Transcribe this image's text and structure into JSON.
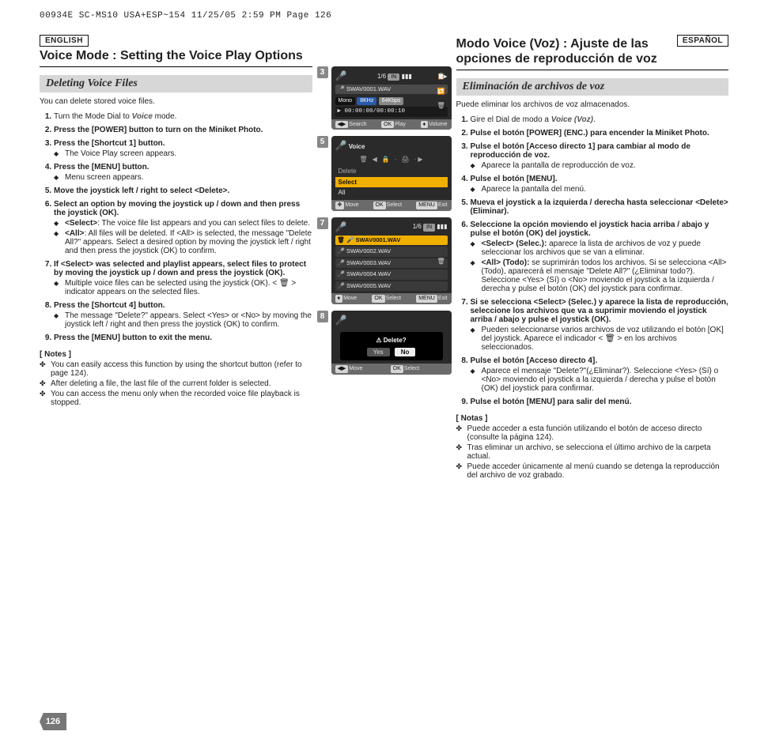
{
  "slug": "00934E SC-MS10 USA+ESP~154  11/25/05 2:59 PM  Page 126",
  "page_number": "126",
  "en": {
    "lang_badge": "ENGLISH",
    "title": "Voice Mode : Setting the Voice Play Options",
    "subhead": "Deleting Voice Files",
    "intro": "You can delete stored voice files.",
    "mode_label_prefix": "Turn the Mode Dial to ",
    "mode_name": "Voice",
    "mode_label_suffix": " mode.",
    "step2": "Press the [POWER] button to turn on the Miniket Photo.",
    "step3": "Press the [Shortcut 1] button.",
    "step3_b1": "The Voice Play screen appears.",
    "step4": "Press the [MENU] button.",
    "step4_b1": "Menu screen appears.",
    "step5": "Move the joystick left / right to select <Delete>.",
    "step6": "Select an option by moving the joystick up / down and then press the joystick (OK).",
    "step6_b1_label": "<Select>",
    "step6_b1_text": ": The voice file list appears and you can select files to delete.",
    "step6_b2_label": "<All>",
    "step6_b2_text": ": All files will be deleted. If <All> is selected, the message \"Delete All?\" appears. Select a desired option by moving the joystick left / right and then press the joystick (OK) to confirm.",
    "step7": "If <Select> was selected and playlist appears, select files to protect by moving the joystick up / down and press the joystick (OK).",
    "step7_b1": "Multiple voice files can be selected using the joystick (OK). < 🗑 > indicator appears on the selected files.",
    "step8": "Press the [Shortcut 4] button.",
    "step8_b1": "The message \"Delete?\" appears. Select <Yes> or <No> by moving the joystick left / right and then press the joystick (OK) to confirm.",
    "step9": "Press the [MENU] button to exit the menu.",
    "notes_head": "[ Notes ]",
    "note1": "You can easily access this function by using the shortcut button (refer to page 124).",
    "note2": "After deleting a file, the last file of the current folder is selected.",
    "note3": "You can access the menu only when the recorded voice file playback is stopped."
  },
  "es": {
    "lang_badge": "ESPAÑOL",
    "title": "Modo Voice (Voz) : Ajuste de las opciones de reproducción de voz",
    "subhead": "Eliminación de archivos de voz",
    "intro": "Puede eliminar los archivos de voz almacenados.",
    "mode_label_prefix": "Gire el Dial de modo a ",
    "mode_name": "Voice (Voz)",
    "mode_label_suffix": ".",
    "step2": "Pulse el botón [POWER] (ENC.) para encender la Miniket Photo.",
    "step3": "Pulse el botón [Acceso directo 1] para cambiar al modo de reproducción de voz.",
    "step3_b1": "Aparece la pantalla de reproducción de voz.",
    "step4": "Pulse el botón [MENU].",
    "step4_b1": "Aparece la pantalla del menú.",
    "step5": "Mueva el joystick a la izquierda / derecha hasta seleccionar <Delete> (Eliminar).",
    "step6": "Seleccione la opción moviendo el joystick hacia arriba / abajo y pulse el botón (OK) del joystick.",
    "step6_b1_label": "<Select> (Selec.):",
    "step6_b1_text": " aparece la lista de archivos de voz y puede seleccionar los archivos que se van a eliminar.",
    "step6_b2_label": "<All> (Todo):",
    "step6_b2_text": " se suprimirán todos los archivos. Si se selecciona <All> (Todo), aparecerá el mensaje \"Delete All?\" (¿Eliminar todo?). Seleccione <Yes> (Sí) o <No> moviendo el joystick a la izquierda / derecha y pulse el botón (OK) del joystick para confirmar.",
    "step7": "Si se selecciona <Select> (Selec.) y aparece la lista de reproducción, seleccione los archivos que va a suprimir moviendo el joystick arriba / abajo y pulse el joystick (OK).",
    "step7_b1": "Pueden seleccionarse varios archivos de voz utilizando el botón [OK] del joystick. Aparece el indicador <  🗑  > en los archivos seleccionados.",
    "step8": "Pulse el botón [Acceso directo 4].",
    "step8_b1": "Aparece el mensaje \"Delete?\"(¿Eliminar?). Seleccione <Yes> (Sí) o <No> moviendo el joystick a la izquierda / derecha y pulse el botón (OK) del joystick para confirmar.",
    "step9": "Pulse el botón [MENU] para salir del menú.",
    "notes_head": "[ Notas ]",
    "note1": "Puede acceder a esta función utilizando el botón de acceso directo (consulte la página 124).",
    "note2": "Tras eliminar un archivo, se selecciona el último archivo de la carpeta actual.",
    "note3": "Puede acceder únicamente al menú cuando se detenga la reproducción del archivo de voz grabado."
  },
  "shots": {
    "s3": {
      "num": "3",
      "counter": "1/6",
      "in": "IN",
      "file": "SWAV0001.WAV",
      "mono": "Mono",
      "khz": "8KHz",
      "kbps": "64Kbps",
      "time": "00:00:00/00:00:10",
      "bb_search": "Search",
      "bb_play": "Play",
      "bb_ok": "OK",
      "bb_vol": "Volume"
    },
    "s5": {
      "num": "5",
      "title": "Voice",
      "item_delete": "Delete",
      "item_select": "Select",
      "item_all": "All",
      "bb_move": "Move",
      "bb_ok": "OK",
      "bb_select": "Select",
      "bb_menu": "MENU",
      "bb_exit": "Exit"
    },
    "s7": {
      "num": "7",
      "counter": "1/6",
      "in": "IN",
      "f1": "SWAV0001.WAV",
      "f2": "SWAV0002.WAV",
      "f3": "SWAV0003.WAV",
      "f4": "SWAV0004.WAV",
      "f5": "SWAV0005.WAV",
      "bb_move": "Move",
      "bb_ok": "OK",
      "bb_select": "Select",
      "bb_menu": "MENU",
      "bb_exit": "Exit"
    },
    "s8": {
      "num": "8",
      "dialog": "Delete?",
      "yes": "Yes",
      "no": "No",
      "bb_move": "Move",
      "bb_ok": "OK",
      "bb_select": "Select"
    }
  }
}
